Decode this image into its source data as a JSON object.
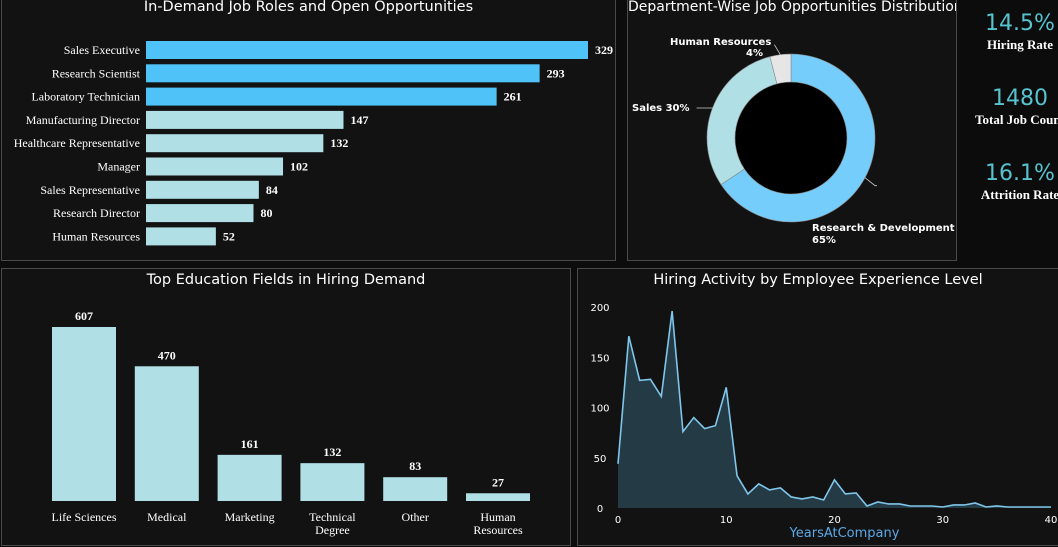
{
  "colors": {
    "accent_bar": "#4fc3f7",
    "light_bar": "#b0e0e6",
    "kpi": "#56c3cf",
    "line": "#7fc6ea",
    "area": "#243a44"
  },
  "panels": {
    "job_roles": {
      "title": "In-Demand Job Roles and Open Opportunities"
    },
    "departments": {
      "title": "Department-Wise Job Opportunities Distribution"
    },
    "education": {
      "title": "Top Education Fields in Hiring Demand"
    },
    "experience": {
      "title": "Hiring Activity by Employee Experience Level"
    }
  },
  "kpis": [
    {
      "value": "14.5%",
      "label": "Hiring Rate"
    },
    {
      "value": "1480",
      "label": "Total Job Count"
    },
    {
      "value": "16.1%",
      "label": "Attrition Rate"
    }
  ],
  "chart_data": [
    {
      "type": "bar",
      "orientation": "horizontal",
      "title": "In-Demand Job Roles and Open Opportunities",
      "categories": [
        "Sales Executive",
        "Research Scientist",
        "Laboratory Technician",
        "Manufacturing Director",
        "Healthcare Representative",
        "Manager",
        "Sales Representative",
        "Research Director",
        "Human Resources"
      ],
      "values": [
        329,
        293,
        261,
        147,
        132,
        102,
        84,
        80,
        52
      ],
      "highlighted": [
        true,
        true,
        true,
        false,
        false,
        false,
        false,
        false,
        false
      ]
    },
    {
      "type": "pie",
      "donut": true,
      "title": "Department-Wise Job Opportunities Distribution",
      "categories": [
        "Research & Development",
        "Sales",
        "Human Resources"
      ],
      "values": [
        65,
        30,
        4
      ],
      "labels": [
        "65%",
        "30%",
        "4%"
      ],
      "colors": [
        "#74cdfa",
        "#b0e0e6",
        "#e6e6e6"
      ]
    },
    {
      "type": "bar",
      "title": "Top Education Fields in Hiring Demand",
      "categories": [
        [
          "Life Sciences"
        ],
        [
          "Medical"
        ],
        [
          "Marketing"
        ],
        [
          "Technical",
          "Degree"
        ],
        [
          "Other"
        ],
        [
          "Human",
          "Resources"
        ]
      ],
      "values": [
        607,
        470,
        161,
        132,
        83,
        27
      ]
    },
    {
      "type": "area",
      "title": "Hiring Activity by Employee Experience Level",
      "xlabel": "YearsAtCompany",
      "ylabel": "",
      "xlim": [
        0,
        40
      ],
      "ylim": [
        0,
        200
      ],
      "xticks": [
        0,
        10,
        20,
        30,
        40
      ],
      "yticks": [
        0,
        50,
        100,
        150,
        200
      ],
      "x": [
        0,
        1,
        2,
        3,
        4,
        5,
        6,
        7,
        8,
        9,
        10,
        11,
        12,
        13,
        14,
        15,
        16,
        17,
        18,
        19,
        20,
        21,
        22,
        23,
        24,
        25,
        26,
        27,
        28,
        29,
        30,
        31,
        32,
        33,
        34,
        35,
        36,
        37,
        40
      ],
      "y": [
        44,
        171,
        127,
        128,
        111,
        196,
        76,
        90,
        79,
        82,
        120,
        32,
        14,
        24,
        18,
        20,
        11,
        9,
        11,
        8,
        28,
        14,
        15,
        2,
        6,
        4,
        4,
        2,
        2,
        2,
        1,
        3,
        3,
        5,
        1,
        2,
        1,
        1,
        1
      ]
    }
  ]
}
